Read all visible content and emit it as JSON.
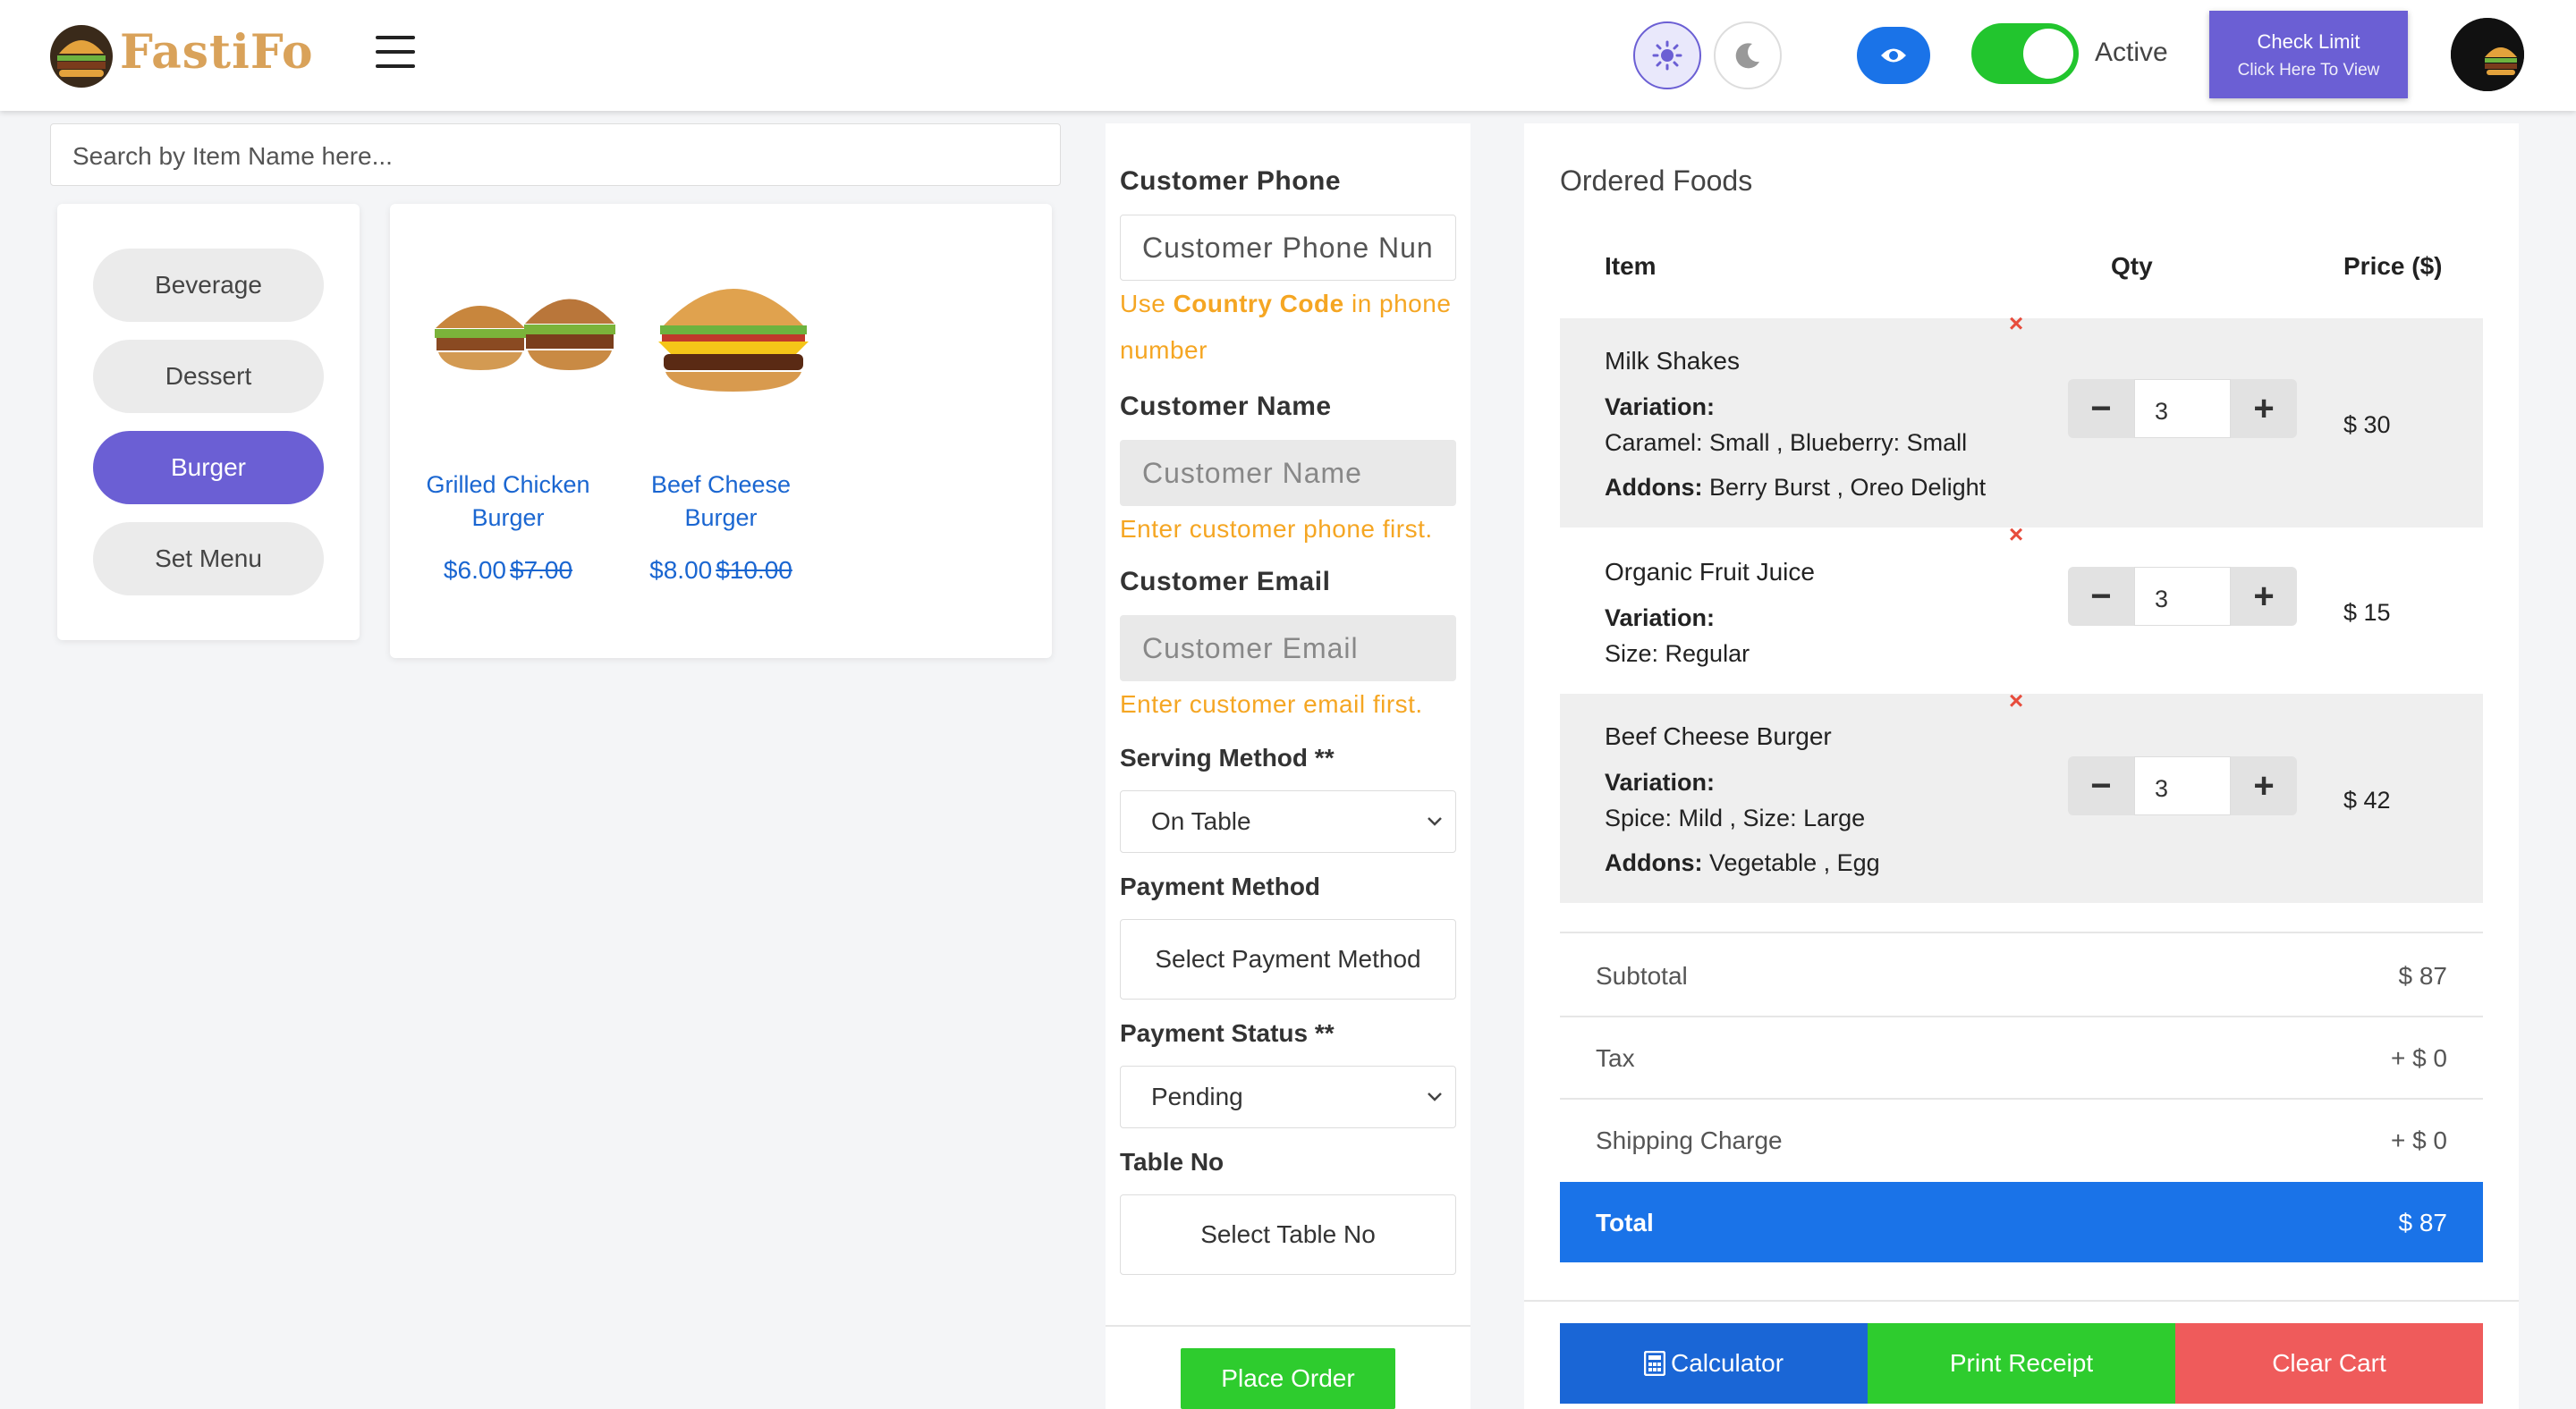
{
  "header": {
    "logo_text": "FastiFo",
    "status_label": "Active",
    "check_limit": {
      "title": "Check Limit",
      "subtitle": "Click Here To View"
    },
    "colors": {
      "accent": "#6b5fd4",
      "primary": "#1a73e8",
      "toggle_on": "#22c52e"
    }
  },
  "search": {
    "placeholder": "Search by Item Name here..."
  },
  "categories": [
    {
      "label": "Beverage",
      "selected": false
    },
    {
      "label": "Dessert",
      "selected": false
    },
    {
      "label": "Burger",
      "selected": true
    },
    {
      "label": "Set Menu",
      "selected": false
    }
  ],
  "products": [
    {
      "name_line1": "Grilled Chicken",
      "name_line2": "Burger",
      "price": "$6.00",
      "old_price": "$7.00",
      "icon": "grilled-chicken-burger-image"
    },
    {
      "name_line1": "Beef Cheese",
      "name_line2": "Burger",
      "price": "$8.00",
      "old_price": "$10.00",
      "icon": "beef-cheese-burger-image"
    }
  ],
  "customer": {
    "phone_label": "Customer Phone",
    "phone_placeholder": "Customer Phone Nun",
    "phone_hint_pre": "Use ",
    "phone_hint_bold": "Country Code",
    "phone_hint_post": " in phone",
    "phone_hint_line2": "number",
    "name_label": "Customer Name",
    "name_placeholder": "Customer Name",
    "name_hint": "Enter customer phone first.",
    "email_label": "Customer Email",
    "email_placeholder": "Customer Email",
    "email_hint": "Enter customer email first.",
    "serving_label": "Serving Method **",
    "serving_value": "On Table",
    "payment_method_label": "Payment Method",
    "payment_method_button": "Select Payment Method",
    "payment_status_label": "Payment Status **",
    "payment_status_value": "Pending",
    "table_label": "Table No",
    "table_button": "Select Table No",
    "place_order": "Place Order"
  },
  "order": {
    "title": "Ordered Foods",
    "columns": {
      "item": "Item",
      "qty": "Qty",
      "price": "Price ($)"
    },
    "items": [
      {
        "name": "Milk Shakes",
        "variation_label": "Variation:",
        "variation": "Caramel: Small , Blueberry: Small",
        "addons_label": "Addons:",
        "addons": "Berry Burst , Oreo Delight",
        "qty": "3",
        "price": "$ 30"
      },
      {
        "name": "Organic Fruit Juice",
        "variation_label": "Variation:",
        "variation": "Size: Regular",
        "qty": "3",
        "price": "$ 15"
      },
      {
        "name": "Beef Cheese Burger",
        "variation_label": "Variation:",
        "variation": "Spice: Mild , Size: Large",
        "addons_label": "Addons:",
        "addons": "Vegetable , Egg",
        "qty": "3",
        "price": "$ 42"
      }
    ],
    "summary": {
      "subtotal_label": "Subtotal",
      "subtotal": "$ 87",
      "tax_label": "Tax",
      "tax": "+ $ 0",
      "shipping_label": "Shipping Charge",
      "shipping": "+ $ 0",
      "total_label": "Total",
      "total": "$ 87"
    },
    "actions": {
      "calculator": "Calculator",
      "print": "Print Receipt",
      "clear": "Clear Cart"
    }
  }
}
